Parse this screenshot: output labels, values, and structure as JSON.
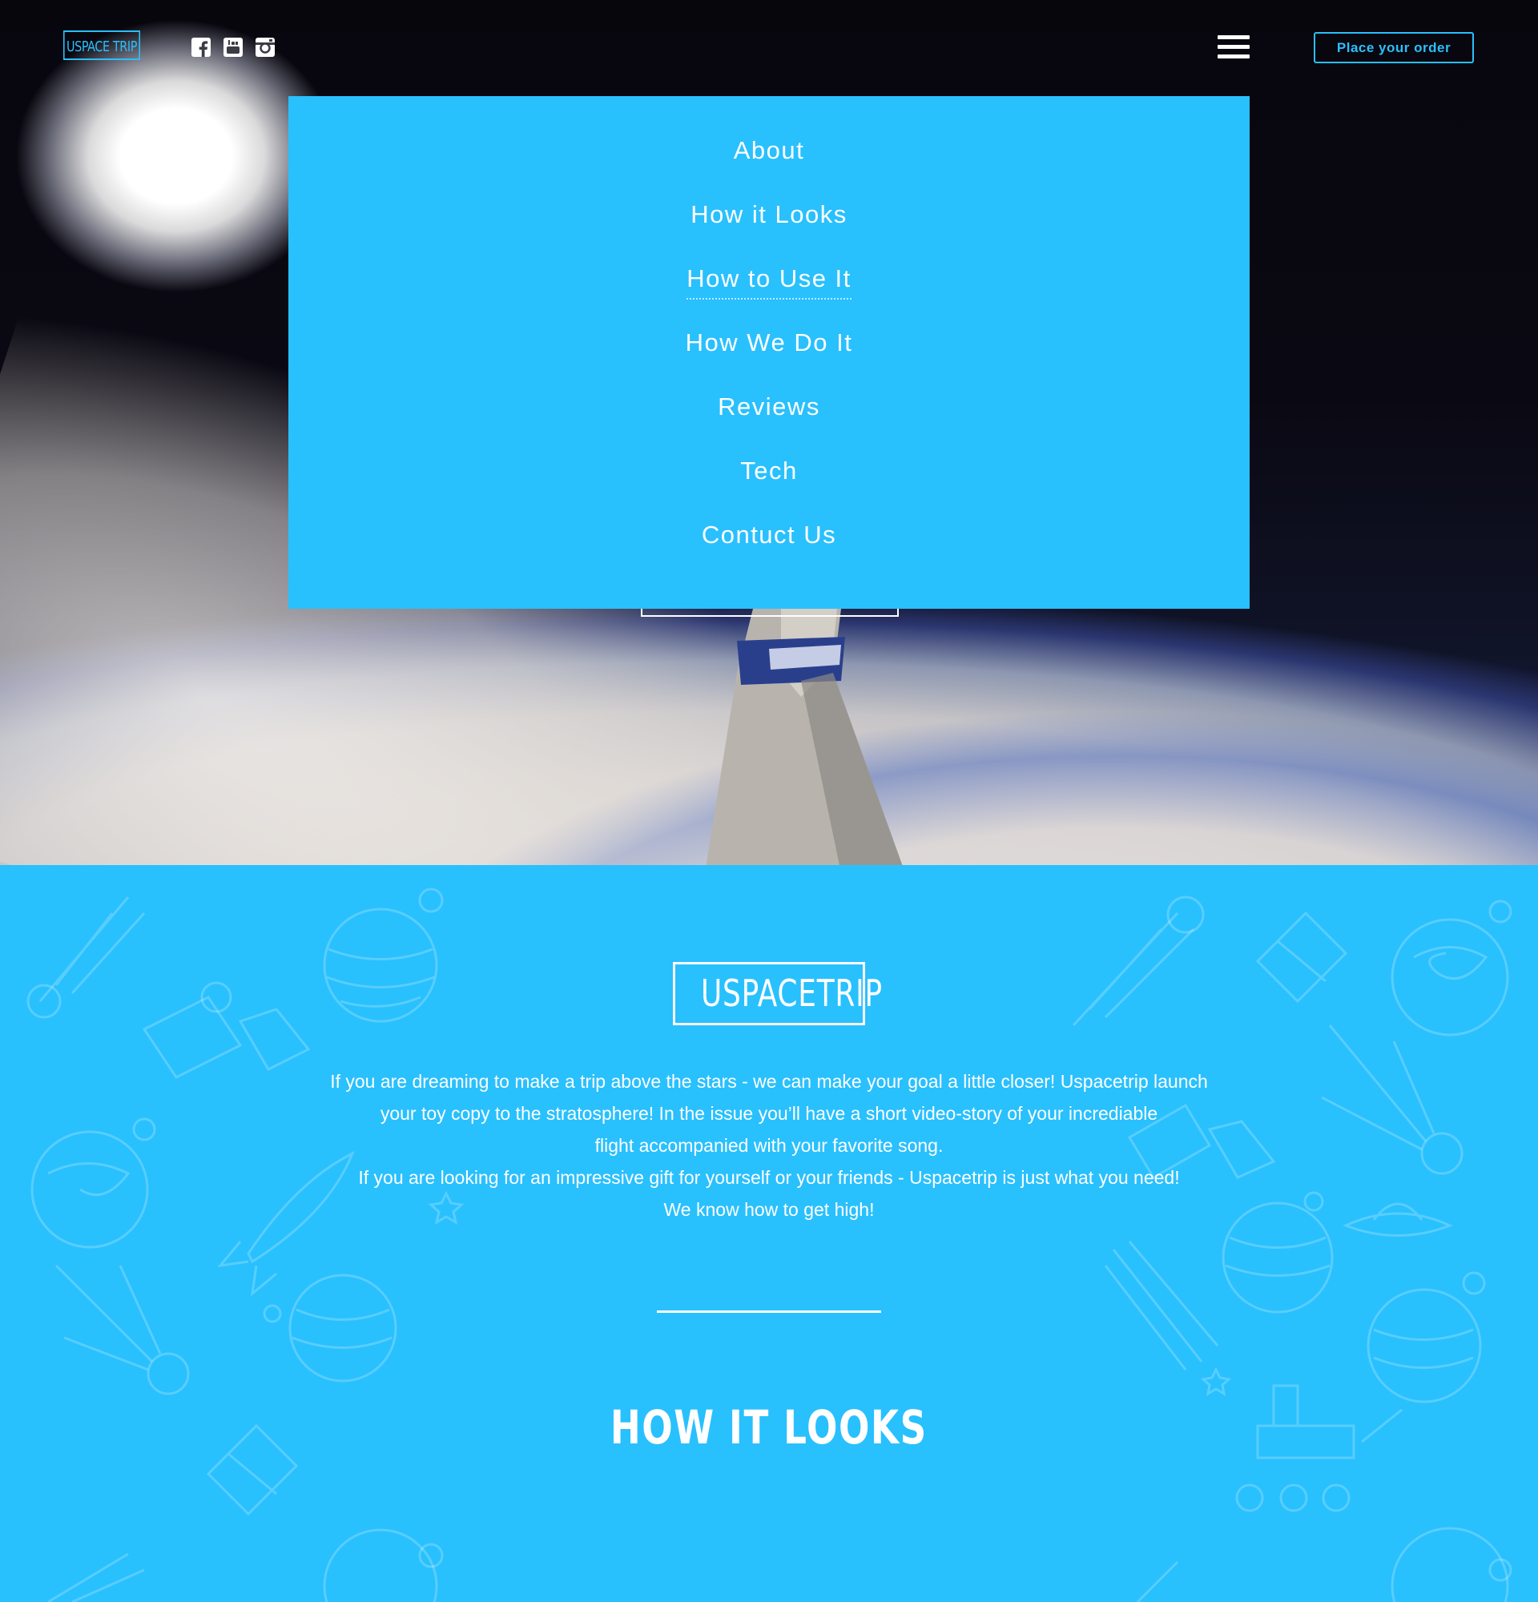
{
  "header": {
    "logo_text": "USPACE TRIP",
    "social": [
      "facebook-icon",
      "youtube-icon",
      "instagram-icon"
    ],
    "menu_icon": "hamburger-menu-icon",
    "order_button": "Place your order"
  },
  "menu": {
    "items": [
      "About",
      "How it Looks",
      "How to Use It",
      "How We Do It",
      "Reviews",
      "Tech",
      "Contuct Us"
    ],
    "active": "How to Use It"
  },
  "intro": {
    "brand": "USPACETRIP",
    "lines": [
      "If you are dreaming to make a trip above the stars - we can make your goal a little closer!  Uspacetrip launch",
      "your toy copy to the stratosphere! In the issue you’ll have a short video-story of your incrediable",
      "flight accompanied with your favorite song.",
      "If you are looking for an impressive gift for yourself or your friends - Uspacetrip is just what you need!",
      "We know how to get high!"
    ]
  },
  "section": {
    "title": "HOW IT LOOKS"
  },
  "colors": {
    "accent": "#29c0fe",
    "text_light": "#ffffff"
  }
}
